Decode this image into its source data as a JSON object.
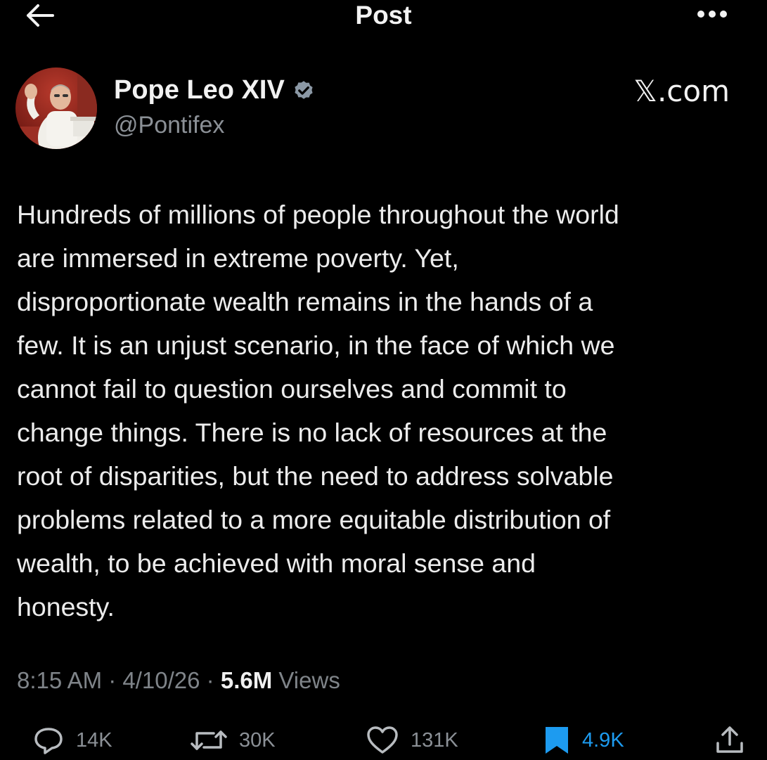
{
  "header": {
    "title": "Post",
    "back_icon": "arrow-left-icon",
    "more_icon": "more-horizontal-icon"
  },
  "author": {
    "display_name": "Pope Leo XIV",
    "handle": "@Pontifex",
    "verified": true,
    "verified_color": "#8b98a5"
  },
  "watermark": "𝕏.com",
  "post": {
    "text": "Hundreds of millions of people throughout the world\nare immersed in extreme poverty. Yet,\ndisproportionate wealth remains in the hands of a\nfew. It is an unjust scenario, in the face of which we\ncannot fail to question ourselves and commit to\nchange things. There is no lack of resources at the\nroot of disparities, but the need to address solvable\nproblems related to a more equitable distribution of\nwealth, to be achieved with moral sense and\nhonesty."
  },
  "meta": {
    "time": "8:15 AM",
    "separator": " · ",
    "date": "4/10/26",
    "views_count": "5.6M",
    "views_label": " Views"
  },
  "actions": {
    "replies": "14K",
    "reposts": "30K",
    "likes": "131K",
    "bookmarks": "4.9K",
    "bookmark_active": true,
    "accent_color": "#1d9bf0",
    "icons": [
      "reply-icon",
      "repost-icon",
      "like-icon",
      "bookmark-icon",
      "share-icon"
    ]
  }
}
